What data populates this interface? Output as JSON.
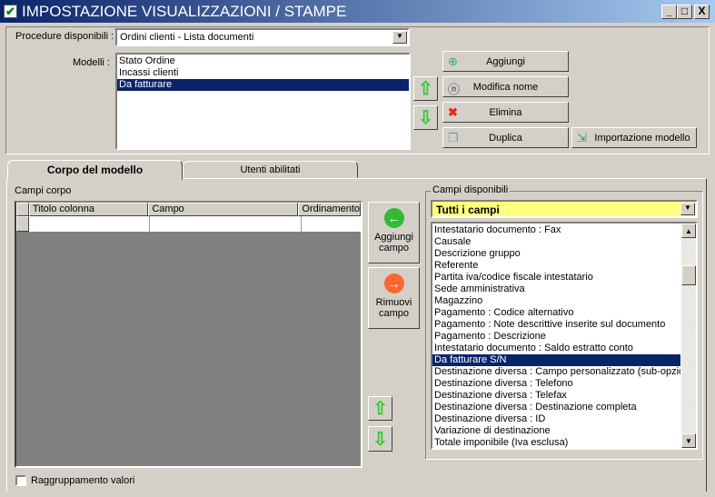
{
  "window": {
    "title": "IMPOSTAZIONE VISUALIZZAZIONI / STAMPE",
    "minimize": "_",
    "maximize": "□",
    "close": "X"
  },
  "top": {
    "procedure_label": "Procedure disponibili :",
    "procedure_value": "Ordini clienti - Lista documenti",
    "modelli_label": "Modelli :",
    "modelli": [
      "Stato Ordine",
      "Incassi clienti",
      "Da fatturare"
    ],
    "selected_modello": "Da fatturare",
    "buttons": {
      "aggiungi": "Aggiungi",
      "modifica": "Modifica nome",
      "elimina": "Elimina",
      "duplica": "Duplica",
      "importazione": "Importazione modello"
    }
  },
  "tabs": [
    {
      "label": "Corpo del modello",
      "active": true
    },
    {
      "label": "Utenti abilitati",
      "active": false
    }
  ],
  "corpo": {
    "label": "Campi corpo",
    "columns": [
      "Titolo colonna",
      "Campo",
      "Ordinamento"
    ],
    "add_button": [
      "Aggiungi",
      "campo"
    ],
    "remove_button": [
      "Rimuovi",
      "campo"
    ],
    "grouping_label": "Raggruppamento valori",
    "grouping_checked": false
  },
  "disponibili": {
    "label": "Campi disponibili",
    "filter": "Tutti i campi",
    "filter_color": "#ffff80",
    "items": [
      "Intestatario documento : Fax",
      "Causale",
      "Descrizione gruppo",
      "Referente",
      "Partita iva/codice fiscale intestatario",
      "Sede amministrativa",
      "Magazzino",
      "Pagamento : Codice alternativo",
      "Pagamento : Note descrittive inserite sul documento",
      "Pagamento : Descrizione",
      "Intestatario documento : Saldo estratto conto",
      "Da fatturare S/N",
      "Destinazione diversa : Campo personalizzato (sub-opzione",
      "Destinazione diversa : Telefono",
      "Destinazione diversa : Telefax",
      "Destinazione diversa : Destinazione completa",
      "Destinazione diversa : ID",
      "Variazione di destinazione",
      "Totale imponibile (Iva esclusa)"
    ],
    "selected": "Da fatturare S/N"
  }
}
